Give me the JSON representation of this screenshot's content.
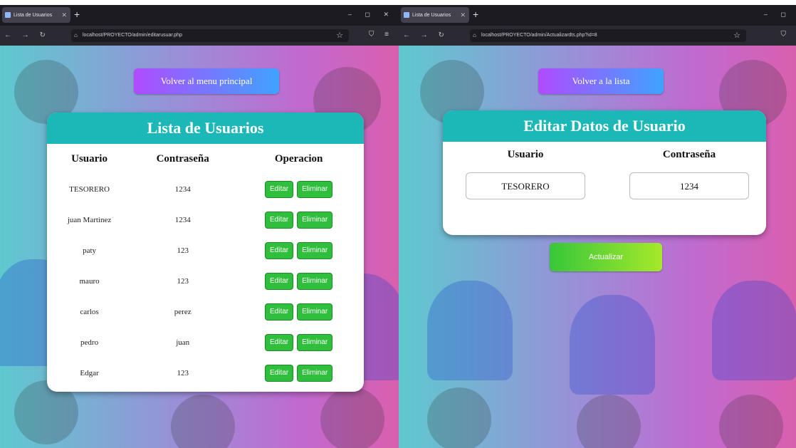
{
  "left_window": {
    "tab_title": "Lista de Usuarios",
    "url": "localhost/PROYECTO/admin/editarusuar.php",
    "back_button": "Volver al menu principal",
    "card_title": "Lista de Usuarios",
    "columns": [
      "Usuario",
      "Contraseña",
      "Operacion"
    ],
    "rows": [
      {
        "usuario": "TESORERO",
        "password": "1234"
      },
      {
        "usuario": "juan Martinez",
        "password": "1234"
      },
      {
        "usuario": "paty",
        "password": "123"
      },
      {
        "usuario": "mauro",
        "password": "123"
      },
      {
        "usuario": "carlos",
        "password": "perez"
      },
      {
        "usuario": "pedro",
        "password": "juan"
      },
      {
        "usuario": "Edgar",
        "password": "123"
      }
    ],
    "edit_label": "Editar",
    "delete_label": "Eliminar"
  },
  "right_window": {
    "tab_title": "Lista de Usuarios",
    "url": "localhost/PROYECTO/admin/Actualizardts.php?id=8",
    "back_button": "Volver a la lista",
    "card_title": "Editar Datos de Usuario",
    "user_label": "Usuario",
    "password_label": "Contraseña",
    "user_value": "TESORERO",
    "password_value": "1234",
    "update_button": "Actualizar"
  },
  "colors": {
    "header_teal": "#1cb8b8",
    "button_green": "#2fbf3c",
    "top_button_gradient": [
      "#b04bff",
      "#3fa3ff"
    ],
    "update_gradient": [
      "#38c73a",
      "#a6e82a"
    ]
  }
}
